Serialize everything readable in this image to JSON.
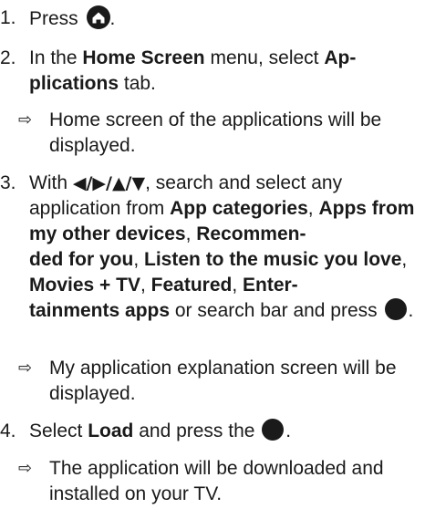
{
  "steps": [
    {
      "number": "1.",
      "parts": [
        "Press ",
        "."
      ],
      "icon": "home-icon"
    },
    {
      "number": "2.",
      "parts": [
        "In the ",
        "Home Screen",
        " menu, select ",
        "Ap-",
        "plications",
        " tab."
      ],
      "result": "Home screen of the applications will be displayed."
    },
    {
      "number": "3.",
      "nav_arrows": "◀/▶/▲/▼",
      "parts": [
        "With ",
        ", search and select any application from ",
        "App categories",
        ", ",
        "Apps from my other devices",
        ", ",
        "Recommen-",
        "ded for you",
        ", ",
        "Listen to the music you love",
        ", ",
        "Movies + TV",
        ", ",
        "Featured",
        ", ",
        "Enter-",
        "tainments apps",
        " or search bar and press ",
        "."
      ],
      "icon": "ok-button-icon",
      "result": "My application explanation screen will be displayed."
    },
    {
      "number": "4.",
      "parts": [
        "Select ",
        "Load",
        " and press the ",
        "."
      ],
      "icon": "ok-button-icon",
      "result": "The application will be downloaded and installed on your TV."
    }
  ],
  "result_arrow": "⇨"
}
